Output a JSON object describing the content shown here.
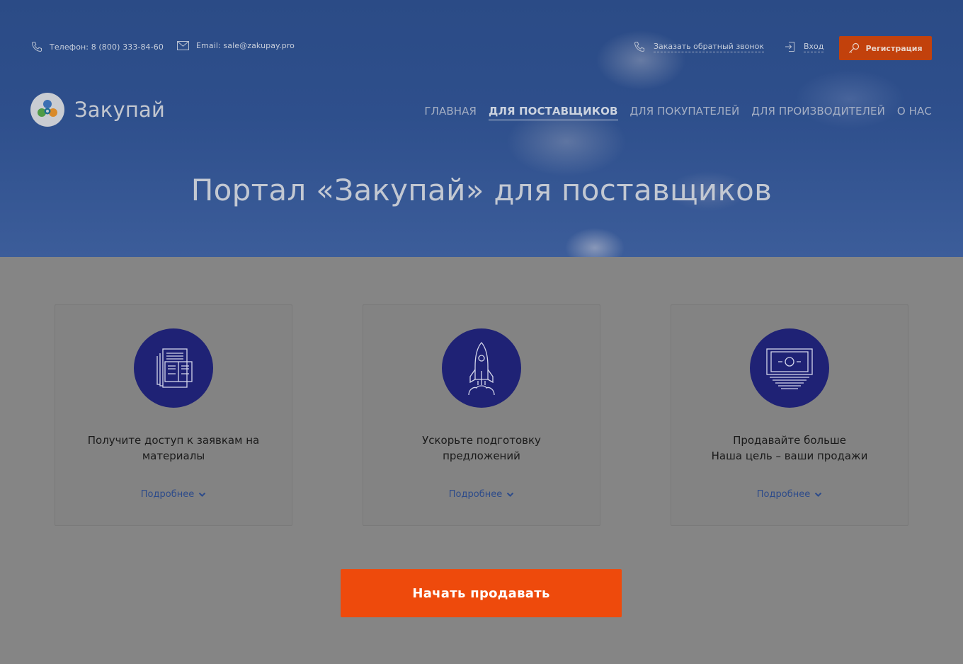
{
  "header": {
    "phone": "Телефон: 8 (800) 333-84-60",
    "email": "Email: sale@zakupay.pro",
    "callback_label": "Заказать обратный звонок",
    "login_label": "Вход",
    "register_label": "Регистрация"
  },
  "logo": {
    "text": "Закупай"
  },
  "nav": {
    "items": [
      {
        "label": "ГЛАВНАЯ"
      },
      {
        "label": "ДЛЯ ПОСТАВЩИКОВ",
        "active": true
      },
      {
        "label": "ДЛЯ ПОКУПАТЕЛЕЙ"
      },
      {
        "label": "ДЛЯ ПРОИЗВОДИТЕЛЕЙ"
      },
      {
        "label": "О НАС"
      }
    ]
  },
  "hero": {
    "title": "Портал «Закупай» для поставщиков"
  },
  "cards": [
    {
      "line1": "Получите доступ к заявкам на",
      "line2": "материалы",
      "more": "Подробнее",
      "icon": "documents-icon"
    },
    {
      "line1": "Ускорьте подготовку",
      "line2": "предложений",
      "more": "Подробнее",
      "icon": "rocket-icon"
    },
    {
      "line1": "Продавайте больше",
      "line2": "Наша цель – ваши продажи",
      "more": "Подробнее",
      "icon": "money-stack-icon"
    }
  ],
  "cta": {
    "label": "Начать продавать"
  },
  "colors": {
    "accent": "#ee4a0c",
    "icon_circle": "#1f2275",
    "link": "#2d4b8a"
  }
}
